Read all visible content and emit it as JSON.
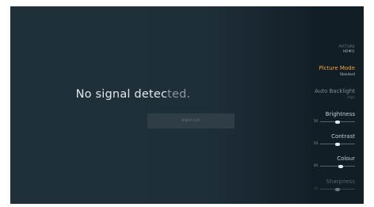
{
  "screen": {
    "message_main": "No signal detec",
    "message_fade": "ted.",
    "input_list_label": "Input List"
  },
  "panel": {
    "title": "PICTURE",
    "source": "HDMI1",
    "settings": {
      "picture_mode": {
        "label": "Picture Mode",
        "value": "Standard"
      },
      "auto_backlight": {
        "label": "Auto Backlight",
        "value": "High"
      },
      "brightness": {
        "label": "Brightness",
        "value": "50",
        "level": 0.5
      },
      "contrast": {
        "label": "Contrast",
        "value": "50",
        "level": 0.5
      },
      "colour": {
        "label": "Colour",
        "value": "60",
        "level": 0.6
      },
      "sharpness": {
        "label": "Sharpness",
        "value": "10",
        "level": 0.5
      }
    }
  },
  "colors": {
    "accent": "#f3a43a",
    "background": "#1f2f39",
    "panel": "#121e26"
  }
}
